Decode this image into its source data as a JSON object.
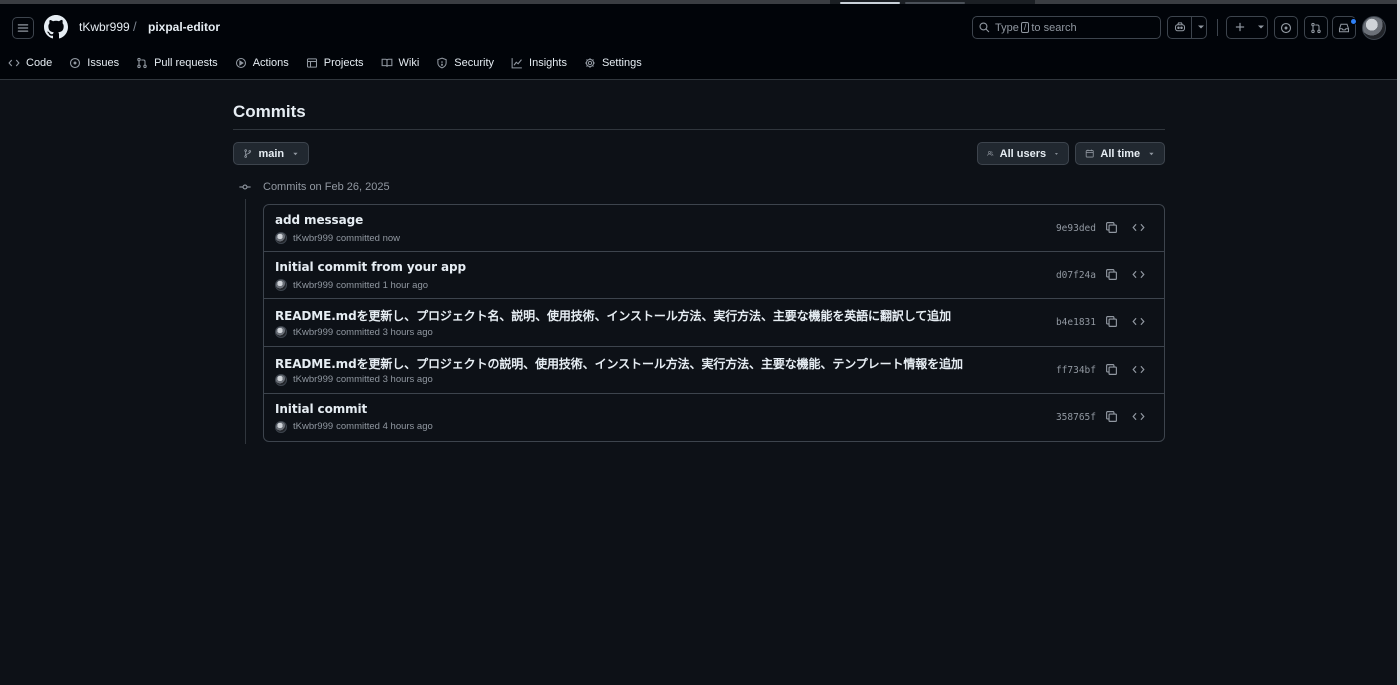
{
  "header": {
    "owner": "tKwbr999",
    "separator": "/",
    "repo": "pixpal-editor",
    "search": {
      "prefix": "Type",
      "key": "/",
      "suffix": "to search"
    }
  },
  "nav": {
    "items": [
      {
        "label": "Code",
        "icon": "code-icon"
      },
      {
        "label": "Issues",
        "icon": "issue-icon"
      },
      {
        "label": "Pull requests",
        "icon": "pull-request-icon"
      },
      {
        "label": "Actions",
        "icon": "play-icon"
      },
      {
        "label": "Projects",
        "icon": "table-icon"
      },
      {
        "label": "Wiki",
        "icon": "book-icon"
      },
      {
        "label": "Security",
        "icon": "shield-icon"
      },
      {
        "label": "Insights",
        "icon": "graph-icon"
      },
      {
        "label": "Settings",
        "icon": "gear-icon"
      }
    ]
  },
  "page": {
    "title": "Commits",
    "branch": "main",
    "users_filter": "All users",
    "time_filter": "All time",
    "group_label": "Commits on Feb 26, 2025"
  },
  "commits": [
    {
      "message": "add message",
      "author": "tKwbr999",
      "action": "committed",
      "time": "now",
      "sha": "9e93ded"
    },
    {
      "message": "Initial commit from your app",
      "author": "tKwbr999",
      "action": "committed",
      "time": "1 hour ago",
      "sha": "d07f24a"
    },
    {
      "message": "README.mdを更新し、プロジェクト名、説明、使用技術、インストール方法、実行方法、主要な機能を英語に翻訳して追加",
      "author": "tKwbr999",
      "action": "committed",
      "time": "3 hours ago",
      "sha": "b4e1831"
    },
    {
      "message": "README.mdを更新し、プロジェクトの説明、使用技術、インストール方法、実行方法、主要な機能、テンプレート情報を追加",
      "author": "tKwbr999",
      "action": "committed",
      "time": "3 hours ago",
      "sha": "ff734bf"
    },
    {
      "message": "Initial commit",
      "author": "tKwbr999",
      "action": "committed",
      "time": "4 hours ago",
      "sha": "358765f"
    }
  ],
  "colors": {
    "background": "#0d1117",
    "header": "#010409",
    "border": "#30363d",
    "text": "#e6edf3",
    "muted": "#9198a1",
    "notification": "#2f81f7"
  }
}
